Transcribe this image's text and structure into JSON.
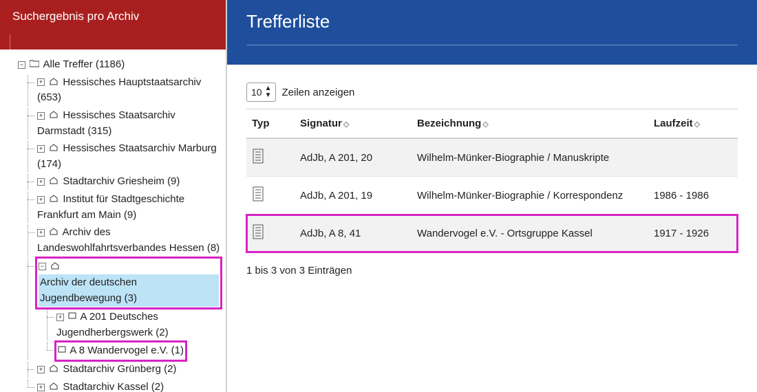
{
  "sidebar": {
    "header": "Suchergebnis pro Archiv",
    "root_label": "Alle Treffer (1186)",
    "nodes": {
      "n0": "Hessisches Hauptstaatsarchiv (653)",
      "n1": "Hessisches Staatsarchiv Darmstadt (315)",
      "n2": "Hessisches Staatsarchiv Marburg (174)",
      "n3": "Stadtarchiv Griesheim (9)",
      "n4": "Institut für Stadtgeschichte Frankfurt am Main (9)",
      "n5": "Archiv des Landeswohlfahrtsverbandes Hessen (8)",
      "n6": "Archiv der deutschen Jugendbewegung (3)",
      "n6a": "A 201 Deutsches Jugendherbergswerk (2)",
      "n6b": "A 8 Wandervogel e.V. (1)",
      "n7": "Stadtarchiv Grünberg (2)",
      "n8": "Stadtarchiv Kassel (2)"
    }
  },
  "main": {
    "title": "Trefferliste",
    "rows_sel_value": "10",
    "rows_label": "Zeilen anzeigen",
    "columns": {
      "typ": "Typ",
      "signatur": "Signatur",
      "bezeichnung": "Bezeichnung",
      "laufzeit": "Laufzeit"
    },
    "rows": [
      {
        "sig": "AdJb, A 201, 20",
        "bez": "Wilhelm-Münker-Biographie / Manuskripte",
        "lauf": ""
      },
      {
        "sig": "AdJb, A 201, 19",
        "bez": "Wilhelm-Münker-Biographie / Korrespondenz",
        "lauf": "1986 - 1986"
      },
      {
        "sig": "AdJb, A 8, 41",
        "bez": "Wandervogel e.V. - Ortsgruppe Kassel",
        "lauf": "1917 - 1926"
      }
    ],
    "results_info": "1 bis 3 von 3 Einträgen"
  }
}
